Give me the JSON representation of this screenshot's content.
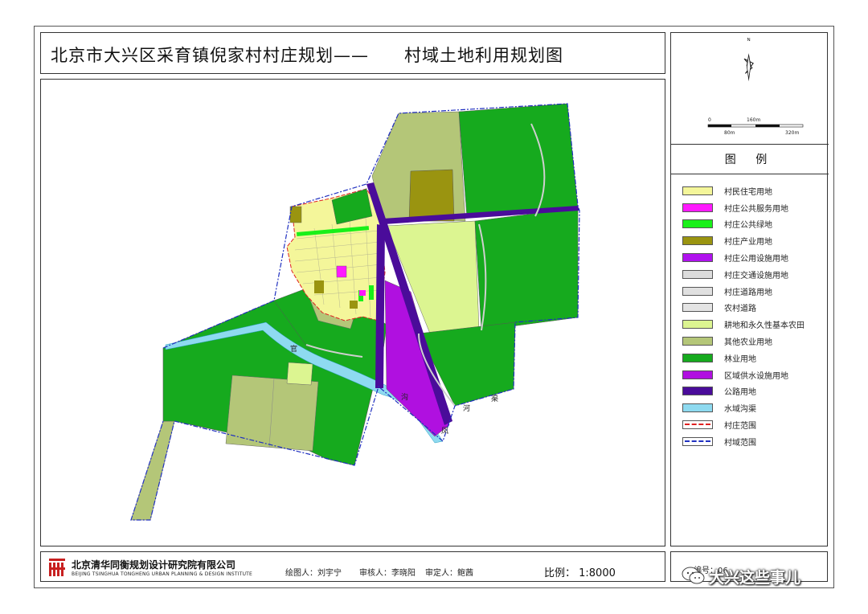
{
  "title": {
    "main": "北京市大兴区采育镇倪家村村庄规划——",
    "sub": "村域土地利用规划图"
  },
  "north": {
    "label": "N"
  },
  "scale_bar": {
    "top_labels": [
      "0",
      "160m"
    ],
    "bottom_labels": [
      "80m",
      "320m"
    ]
  },
  "legend": {
    "title": "图 例",
    "items": [
      {
        "label": "村民住宅用地",
        "color": "#f4f69a",
        "type": "fill"
      },
      {
        "label": "村庄公共服务用地",
        "color": "#ff1aff",
        "type": "fill"
      },
      {
        "label": "村庄公共绿地",
        "color": "#19f019",
        "type": "fill"
      },
      {
        "label": "村庄产业用地",
        "color": "#9a9410",
        "type": "fill"
      },
      {
        "label": "村庄公用设施用地",
        "color": "#b012ee",
        "type": "fill"
      },
      {
        "label": "村庄交通设施用地",
        "color": "#dcdcdc",
        "type": "fill"
      },
      {
        "label": "村庄道路用地",
        "color": "#e0e0e0",
        "type": "fill"
      },
      {
        "label": "农村道路",
        "color": "#e4e4e4",
        "type": "fill"
      },
      {
        "label": "耕地和永久性基本农田",
        "color": "#dcf591",
        "type": "fill"
      },
      {
        "label": "其他农业用地",
        "color": "#b4c678",
        "type": "fill"
      },
      {
        "label": "林业用地",
        "color": "#16aa1e",
        "type": "fill"
      },
      {
        "label": "区域供水设施用地",
        "color": "#b010e0",
        "type": "fill"
      },
      {
        "label": "公路用地",
        "color": "#4a0c9a",
        "type": "fill"
      },
      {
        "label": "水域沟渠",
        "color": "#8edaf0",
        "type": "fill"
      },
      {
        "label": "村庄范围",
        "color": "#e02020",
        "type": "line"
      },
      {
        "label": "村域范围",
        "color": "#2030c0",
        "type": "line"
      }
    ]
  },
  "map_labels": {
    "river_1": "官",
    "river_2": "沟",
    "river_3": "凤",
    "river_4": "河",
    "river_5": "渠"
  },
  "footer": {
    "company_cn": "北京清华同衡规划设计研究院有限公司",
    "company_en": "BEIJING TSINGHUA TONGHENG URBAN PLANNING & DESIGN INSTITUTE",
    "drawn_by": "绘图人：刘宇宁",
    "checked_by": "审核人：李晓阳",
    "approved_by": "审定人：鲍茜",
    "scale": "比例：  1:8000",
    "drawing_no": "编号：06"
  },
  "watermark": {
    "text": "大兴这些事儿"
  }
}
